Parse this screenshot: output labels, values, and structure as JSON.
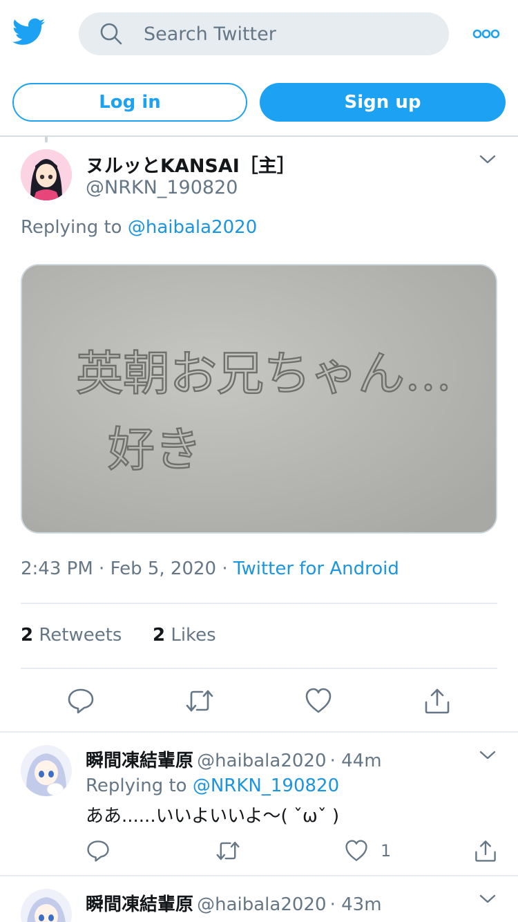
{
  "header": {
    "search_placeholder": "Search Twitter",
    "login_label": "Log in",
    "signup_label": "Sign up"
  },
  "tweet": {
    "display_name": "ヌルッとKANSAI［主］",
    "handle": "@NRKN_190820",
    "replying_label": "Replying to",
    "replying_to": "@haibala2020",
    "media_text_line1": "英朝お兄ちゃん…",
    "media_text_line2": "好き",
    "time": "2:43 PM",
    "date": "Feb 5, 2020",
    "source": "Twitter for Android",
    "retweets_count": "2",
    "retweets_label": "Retweets",
    "likes_count": "2",
    "likes_label": "Likes"
  },
  "replies": [
    {
      "display_name": "瞬間凍結輩原",
      "handle": "@haibala2020",
      "age": "44m",
      "replying_label": "Replying to",
      "replying_to": "@NRKN_190820",
      "text": "ああ......いいよいいよ～( ˇωˇ )",
      "likes": "1"
    },
    {
      "display_name": "瞬間凍結輩原",
      "handle": "@haibala2020",
      "age": "43m"
    }
  ],
  "colors": {
    "accent": "#1da1f2",
    "link": "#1b95e0",
    "secondary_text": "#657786",
    "divider": "#e6ecf0"
  },
  "icons": [
    "twitter-bird-icon",
    "search-icon",
    "more-dots-icon",
    "chevron-down-icon",
    "reply-icon",
    "retweet-icon",
    "like-icon",
    "share-icon"
  ]
}
